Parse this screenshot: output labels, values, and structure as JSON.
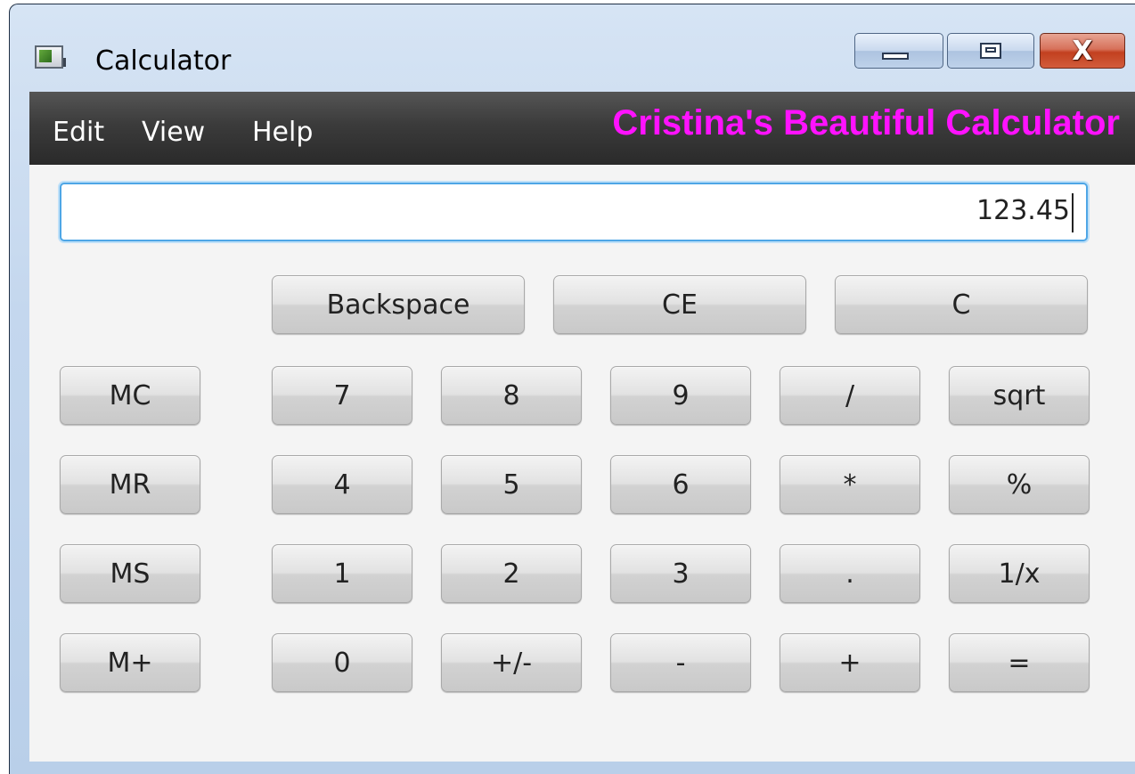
{
  "window": {
    "title": "Calculator",
    "controls": {
      "minimize_icon": "minimize-icon",
      "maximize_icon": "maximize-icon",
      "close_icon": "close-icon",
      "close_glyph": "X"
    }
  },
  "menu": {
    "items": [
      "Edit",
      "View",
      "Help"
    ],
    "banner": "Cristina's Beautiful Calculator",
    "banner_color": "#ff12ff"
  },
  "display": {
    "value": "123.45"
  },
  "buttons": {
    "backspace": "Backspace",
    "ce": "CE",
    "c": "C",
    "mc": "MC",
    "mr": "MR",
    "ms": "MS",
    "mplus": "M+",
    "d7": "7",
    "d8": "8",
    "d9": "9",
    "d4": "4",
    "d5": "5",
    "d6": "6",
    "d1": "1",
    "d2": "2",
    "d3": "3",
    "d0": "0",
    "divide": "/",
    "multiply": "*",
    "decimal": ".",
    "plus": "+",
    "sign": "+/-",
    "minus": "-",
    "sqrt": "sqrt",
    "percent": "%",
    "reciprocal": "1/x",
    "equals": "="
  }
}
